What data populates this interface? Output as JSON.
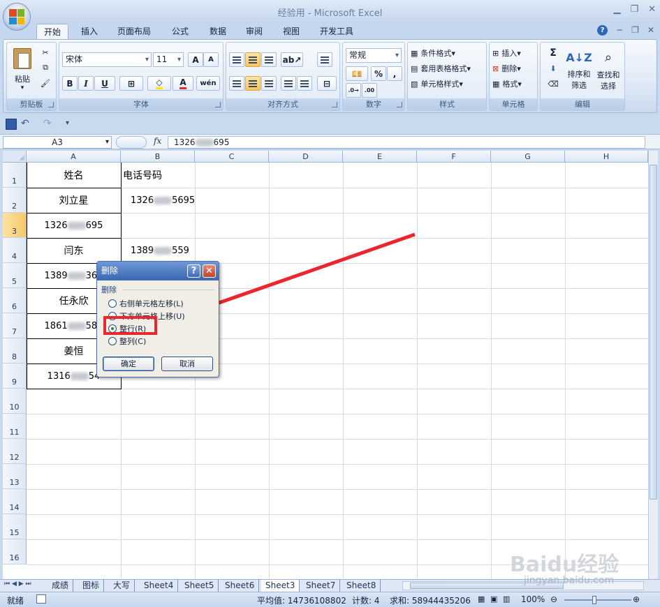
{
  "window": {
    "title": "经验用 - Microsoft Excel"
  },
  "tabs": [
    "开始",
    "插入",
    "页面布局",
    "公式",
    "数据",
    "审阅",
    "视图",
    "开发工具"
  ],
  "ribbon": {
    "clipboard": {
      "label": "剪贴板",
      "paste": "粘贴"
    },
    "font": {
      "label": "字体",
      "name": "宋体",
      "size": "11",
      "bold": "B",
      "italic": "I",
      "underline": "U",
      "size_up": "A",
      "size_down": "A"
    },
    "alignment": {
      "label": "对齐方式"
    },
    "number": {
      "label": "数字",
      "format": "常规",
      "percent": "%",
      "comma": ",",
      "inc_dec": "←.0\n.00",
      "dec_dec": ".00\n→.0"
    },
    "styles": {
      "label": "样式",
      "conditional": "条件格式",
      "table": "套用表格格式",
      "cell": "单元格样式"
    },
    "cells": {
      "label": "单元格",
      "insert": "插入",
      "delete": "删除",
      "format": "格式"
    },
    "editing": {
      "label": "编辑",
      "sigma": "Σ",
      "sort": "排序和",
      "sort2": "筛选",
      "find": "查找和",
      "find2": "选择"
    }
  },
  "formula_bar": {
    "name_box": "A3",
    "fx": "fx",
    "value_prefix": "1326",
    "value_suffix": "695"
  },
  "columns": [
    "A",
    "B",
    "C",
    "D",
    "E",
    "F",
    "G",
    "H"
  ],
  "rows": [
    "1",
    "2",
    "3",
    "4",
    "5",
    "6",
    "7",
    "8",
    "9",
    "10",
    "11",
    "12",
    "13",
    "14",
    "15",
    "16"
  ],
  "cells": {
    "A1": "姓名",
    "B1": "电话号码",
    "A2": "刘立星",
    "B2_prefix": "1326",
    "B2_suffix": "5695",
    "A3_prefix": "1326",
    "A3_suffix": "695",
    "A4": "闫东",
    "B4_prefix": "1389",
    "B4_suffix": "559",
    "A5_prefix": "1389",
    "A5_suffix": "365",
    "A6": "任永欣",
    "A7_prefix": "1861",
    "A7_suffix": "589",
    "A8": "姜恒",
    "A9_prefix": "1316",
    "A9_suffix": "54"
  },
  "dialog": {
    "title": "删除",
    "help": "?",
    "close": "✕",
    "section": "删除",
    "options": [
      {
        "label": "右侧单元格左移(L)",
        "checked": false
      },
      {
        "label": "下方单元格上移(U)",
        "checked": false
      },
      {
        "label": "整行(R)",
        "checked": true
      },
      {
        "label": "整列(C)",
        "checked": false
      }
    ],
    "ok": "确定",
    "cancel": "取消"
  },
  "sheets": [
    "成绩",
    "图标",
    "大写",
    "Sheet4",
    "Sheet5",
    "Sheet6",
    "Sheet3",
    "Sheet7",
    "Sheet8"
  ],
  "active_sheet": "Sheet3",
  "status": {
    "ready": "就绪",
    "average": "平均值: 14736108802",
    "count": "计数: 4",
    "sum": "求和: 58944435206",
    "zoom": "100%"
  },
  "watermark": {
    "main": "Baidu经验",
    "sub": "jingyan.baidu.com"
  },
  "accent": "#e8272e"
}
